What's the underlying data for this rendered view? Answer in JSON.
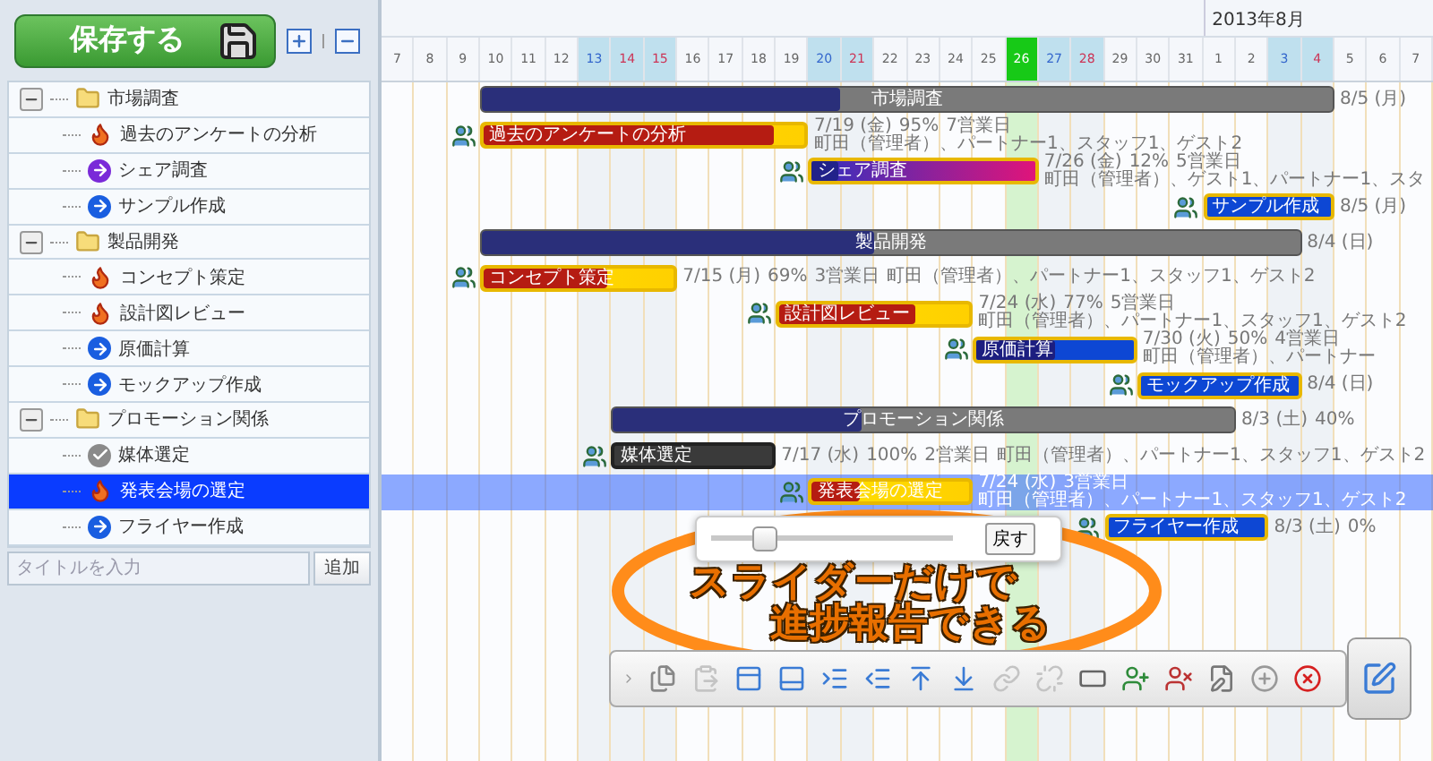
{
  "save_button": {
    "label": "保存する"
  },
  "title_input": {
    "placeholder": "タイトルを入力"
  },
  "add_button": {
    "label": "追加"
  },
  "months": [
    {
      "label": "2013年8月"
    }
  ],
  "days": [
    {
      "label": "7",
      "kind": "weekday"
    },
    {
      "label": "8",
      "kind": "weekday"
    },
    {
      "label": "9",
      "kind": "weekday"
    },
    {
      "label": "10",
      "kind": "weekday"
    },
    {
      "label": "11",
      "kind": "weekday"
    },
    {
      "label": "12",
      "kind": "weekday"
    },
    {
      "label": "13",
      "kind": "saturday"
    },
    {
      "label": "14",
      "kind": "sunday"
    },
    {
      "label": "15",
      "kind": "holiday"
    },
    {
      "label": "16",
      "kind": "weekday"
    },
    {
      "label": "17",
      "kind": "weekday"
    },
    {
      "label": "18",
      "kind": "weekday"
    },
    {
      "label": "19",
      "kind": "weekday"
    },
    {
      "label": "20",
      "kind": "saturday"
    },
    {
      "label": "21",
      "kind": "sunday"
    },
    {
      "label": "22",
      "kind": "weekday"
    },
    {
      "label": "23",
      "kind": "weekday"
    },
    {
      "label": "24",
      "kind": "weekday"
    },
    {
      "label": "25",
      "kind": "weekday"
    },
    {
      "label": "26",
      "kind": "today"
    },
    {
      "label": "27",
      "kind": "saturday"
    },
    {
      "label": "28",
      "kind": "sunday"
    },
    {
      "label": "29",
      "kind": "weekday"
    },
    {
      "label": "30",
      "kind": "weekday"
    },
    {
      "label": "31",
      "kind": "weekday"
    },
    {
      "label": "1",
      "kind": "weekday"
    },
    {
      "label": "2",
      "kind": "weekday"
    },
    {
      "label": "3",
      "kind": "saturday"
    },
    {
      "label": "4",
      "kind": "sunday"
    },
    {
      "label": "5",
      "kind": "weekday"
    },
    {
      "label": "6",
      "kind": "weekday"
    },
    {
      "label": "7",
      "kind": "weekday"
    }
  ],
  "tree": [
    {
      "kind": "group",
      "label": "市場調査",
      "expanded": true,
      "selected": false,
      "bar": {
        "label": "市場調査",
        "level": 0.42,
        "end_label": "8/5 (月)"
      },
      "children": [
        {
          "kind": "late",
          "label": "過去のアンケートの分析",
          "selected": false,
          "bar": {
            "label": "過去のアンケートの分析",
            "level": 0.9,
            "end_label": "7/19 (金)",
            "percent": "95%",
            "days": "7営業日",
            "members": "町田（管理者）、パートナー1、スタッフ1、ゲスト2"
          }
        },
        {
          "kind": "active",
          "label": "シェア調査",
          "selected": false,
          "bar": {
            "label": "シェア調査",
            "level": 0.12,
            "end_label": "7/26 (金)",
            "percent": "12%",
            "days": "5営業日",
            "members": "町田（管理者）、ゲスト1、パートナー1、スタ"
          }
        },
        {
          "kind": "todo",
          "label": "サンプル作成",
          "selected": false,
          "bar": {
            "label": "サンプル作成",
            "level": 0,
            "end_label": "8/5 (月)"
          }
        }
      ]
    },
    {
      "kind": "group",
      "label": "製品開発",
      "expanded": true,
      "selected": false,
      "bar": {
        "label": "製品開発",
        "level": 0.48,
        "end_label": "8/4 (日)"
      },
      "children": [
        {
          "kind": "late",
          "label": "コンセプト策定",
          "selected": false,
          "bar": {
            "label": "コンセプト策定",
            "level": 0.65,
            "end_label": "7/15 (月)",
            "percent": "69%",
            "days": "3営業日",
            "members": "町田（管理者）、パートナー1、スタッフ1、ゲスト2"
          }
        },
        {
          "kind": "late",
          "label": "設計図レビュー",
          "selected": false,
          "bar": {
            "label": "設計図レビュー",
            "level": 0.72,
            "end_label": "7/24 (水)",
            "percent": "77%",
            "days": "5営業日",
            "members": "町田（管理者）、パートナー1、スタッフ1、ゲスト2"
          }
        },
        {
          "kind": "todo",
          "label": "原価計算",
          "selected": false,
          "bar": {
            "label": "原価計算",
            "level": 0.5,
            "end_label": "7/30 (火)",
            "percent": "50%",
            "days": "4営業日",
            "members": "町田（管理者）、パートナー"
          }
        },
        {
          "kind": "todo",
          "label": "モックアップ作成",
          "selected": false,
          "bar": {
            "label": "モックアップ作成",
            "level": 0,
            "end_label": "8/4 (日)"
          }
        }
      ]
    },
    {
      "kind": "group",
      "label": "プロモーション関係",
      "expanded": true,
      "selected": false,
      "bar": {
        "label": "プロモーション関係",
        "level": 0.4,
        "end_label": "8/3 (土)",
        "percent": "40%"
      },
      "children": [
        {
          "kind": "done",
          "label": "媒体選定",
          "selected": false,
          "bar": {
            "label": "媒体選定",
            "level": 1,
            "end_label": "7/17 (水)",
            "percent": "100%",
            "days": "2営業日",
            "members": "町田（管理者）、パートナー1、スタッフ1、ゲスト2"
          }
        },
        {
          "kind": "late",
          "label": "発表会場の選定",
          "selected": true,
          "bar": {
            "label": "発表会場の選定",
            "level": 0.3,
            "end_label": "7/24 (水)",
            "days": "3営業日",
            "members": "町田（管理者）、パートナー1、スタッフ1、ゲスト2"
          }
        },
        {
          "kind": "todo",
          "label": "フライヤー作成",
          "selected": false,
          "bar": {
            "label": "フライヤー作成",
            "level": 0,
            "end_label": "8/3 (土)",
            "percent": "0%"
          }
        }
      ]
    }
  ],
  "progress_popup": {
    "level": 0.22,
    "reset_label": "戻す"
  },
  "annotation": {
    "lines": [
      "スライダーだけで",
      "進捗報告できる"
    ]
  },
  "toolbar": {
    "buttons": [
      {
        "disabled": false
      },
      {
        "disabled": true
      },
      {
        "disabled": false
      },
      {
        "disabled": false
      },
      {
        "disabled": false
      },
      {
        "disabled": false
      },
      {
        "disabled": false
      },
      {
        "disabled": false
      },
      {
        "disabled": true
      },
      {
        "disabled": true
      },
      {
        "disabled": false
      },
      {
        "disabled": false
      },
      {
        "disabled": false
      },
      {
        "disabled": false
      },
      {
        "disabled": false
      },
      {
        "disabled": false
      }
    ]
  }
}
